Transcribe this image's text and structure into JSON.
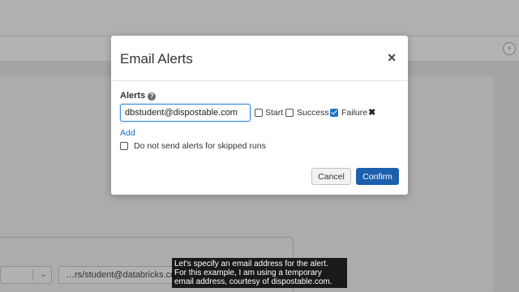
{
  "background": {
    "email_field_value": "…rs/student@databricks.co",
    "nav_icon": "chevron-right-icon"
  },
  "modal": {
    "title": "Email Alerts",
    "close_icon": "close-icon",
    "alerts_label": "Alerts",
    "help_icon": "help-icon",
    "email_value": "dbstudent@dispostable.com",
    "checkboxes": [
      {
        "label": "Start",
        "checked": false
      },
      {
        "label": "Success",
        "checked": false
      },
      {
        "label": "Failure",
        "checked": true
      }
    ],
    "remove_icon": "remove-icon",
    "add_label": "Add",
    "skipped_runs": {
      "label": "Do not send alerts for skipped runs",
      "checked": false
    },
    "cancel_label": "Cancel",
    "confirm_label": "Confirm"
  },
  "caption": {
    "lines": [
      "Let's specify an email address for the alert.",
      "For this example, I am using a temporary",
      "email address, courtesy of dispostable.com."
    ]
  },
  "colors": {
    "primary_button": "#1c5fad",
    "link": "#1a6fc4",
    "checkbox_checked": "#1a73c9"
  }
}
